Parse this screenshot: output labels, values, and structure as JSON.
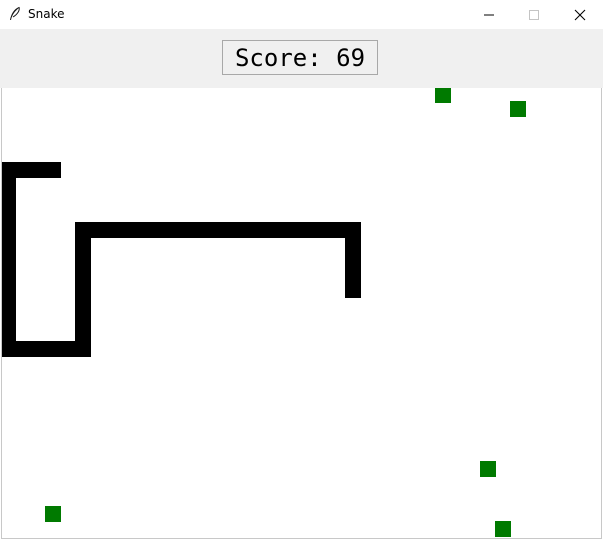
{
  "window": {
    "title": "Snake",
    "controls": {
      "minimize": "minimize",
      "maximize": "maximize",
      "close": "close"
    }
  },
  "score": {
    "label": "Score:",
    "value": "69"
  },
  "colors": {
    "snake": "#000000",
    "food": "#007a00",
    "header_bg": "#f0f0f0",
    "canvas_bg": "#ffffff"
  }
}
